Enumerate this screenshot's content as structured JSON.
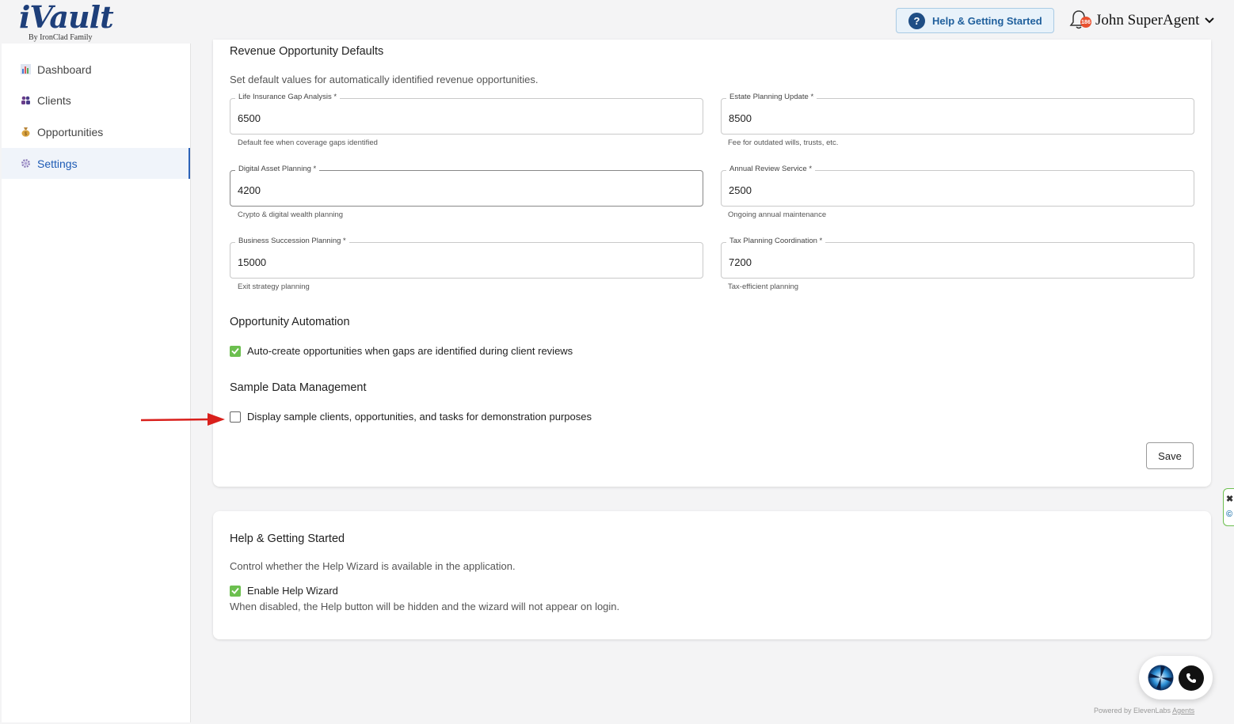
{
  "header": {
    "logo_text": "iVault",
    "logo_sub": "By IronClad Family",
    "help_button_label": "Help & Getting Started",
    "notification_count": "186",
    "user_name": "John SuperAgent"
  },
  "sidebar": {
    "items": [
      {
        "label": "Dashboard",
        "icon": "bar-chart-icon"
      },
      {
        "label": "Clients",
        "icon": "users-icon"
      },
      {
        "label": "Opportunities",
        "icon": "money-bag-icon"
      },
      {
        "label": "Settings",
        "icon": "gear-icon",
        "active": true
      }
    ]
  },
  "revenue": {
    "title": "Revenue Opportunity Defaults",
    "description": "Set default values for automatically identified revenue opportunities.",
    "fields": [
      {
        "label": "Life Insurance Gap Analysis *",
        "value": "6500",
        "help": "Default fee when coverage gaps identified"
      },
      {
        "label": "Estate Planning Update *",
        "value": "8500",
        "help": "Fee for outdated wills, trusts, etc."
      },
      {
        "label": "Digital Asset Planning *",
        "value": "4200",
        "help": "Crypto & digital wealth planning"
      },
      {
        "label": "Annual Review Service *",
        "value": "2500",
        "help": "Ongoing annual maintenance"
      },
      {
        "label": "Business Succession Planning *",
        "value": "15000",
        "help": "Exit strategy planning"
      },
      {
        "label": "Tax Planning Coordination *",
        "value": "7200",
        "help": "Tax-efficient planning"
      }
    ]
  },
  "automation": {
    "title": "Opportunity Automation",
    "checkbox_label": "Auto-create opportunities when gaps are identified during client reviews",
    "checked": true
  },
  "sample_data": {
    "title": "Sample Data Management",
    "checkbox_label": "Display sample clients, opportunities, and tasks for demonstration purposes",
    "checked": false
  },
  "save_label": "Save",
  "help_section": {
    "title": "Help & Getting Started",
    "description": "Control whether the Help Wizard is available in the application.",
    "checkbox_label": "Enable Help Wizard",
    "checked": true,
    "note": "When disabled, the Help button will be hidden and the wizard will not appear on login."
  },
  "elevenlabs": {
    "powered_prefix": "Powered by ElevenLabs",
    "powered_link": "Agents"
  },
  "colors": {
    "brand": "#1e3f7a",
    "accent": "#1d5bb5",
    "checkbox_checked": "#6cbf4f",
    "badge": "#e8502f",
    "arrow": "#d9201c"
  }
}
